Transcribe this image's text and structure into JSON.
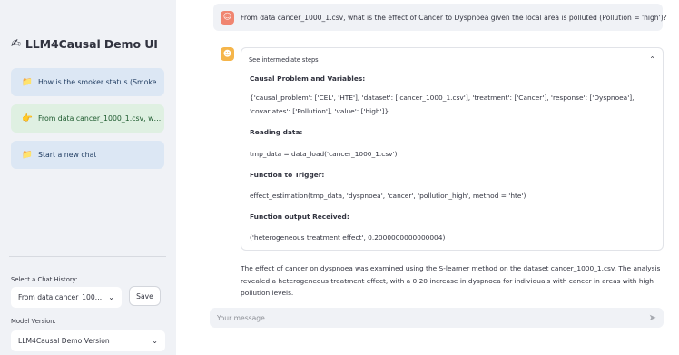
{
  "sidebar": {
    "title": "LLM4Causal Demo UI",
    "title_icon": "pen-icon",
    "history_items": [
      {
        "icon": "folder-icon",
        "label": "How is the smoker status (Smoker…"
      },
      {
        "icon": "pointing-hand-icon",
        "label": "From data cancer_1000_1.csv, wha…"
      },
      {
        "icon": "folder-icon",
        "label": "Start a new chat"
      }
    ],
    "chat_history_label": "Select a Chat History:",
    "chat_history_value": "From data cancer_100…",
    "save_label": "Save",
    "model_version_label": "Model Version:",
    "model_version_value": "LLM4Causal Demo Version"
  },
  "main": {
    "user_message": "From data cancer_1000_1.csv, what is the effect of Cancer to Dyspnoea given the local area is polluted (Pollution = 'high')?",
    "steps": {
      "toggle_label": "See intermediate steps",
      "causal_heading": "Causal Problem and Variables:",
      "causal_line1": "{'causal_problem': ['CEL', 'HTE'], 'dataset': ['cancer_1000_1.csv'], 'treatment': ['Cancer'], 'response': ['Dyspnoea'],",
      "causal_line2": "'covariates': ['Pollution'], 'value': ['high']}",
      "reading_heading": "Reading data:",
      "reading_code": "tmp_data = data_load('cancer_1000_1.csv')",
      "trigger_heading": "Function to Trigger:",
      "trigger_code": "effect_estimation(tmp_data, 'dyspnoea', 'cancer', 'pollution_high', method = 'hte')",
      "output_heading": "Function output Received:",
      "output_value": "('heterogeneous treatment effect', 0.2000000000000004)"
    },
    "answer": "The effect of cancer on dyspnoea was examined using the S-learner method on the dataset cancer_1000_1.csv. The analysis revealed a heterogeneous treatment effect, with a 0.20 increase in dyspnoea for individuals with cancer in areas with high pollution levels.",
    "input_placeholder": "Your message"
  },
  "icons": {
    "user_avatar": "face-icon",
    "bot_avatar": "robot-icon",
    "send": "send-icon",
    "expander_caret": "chevron-up-icon",
    "select_caret": "chevron-down-icon"
  },
  "colors": {
    "sidebar_bg": "#f0f2f6",
    "item_blue": "#dce7f4",
    "item_green": "#dff0e2",
    "user_avatar": "#f08570",
    "bot_avatar": "#f5b54a"
  }
}
